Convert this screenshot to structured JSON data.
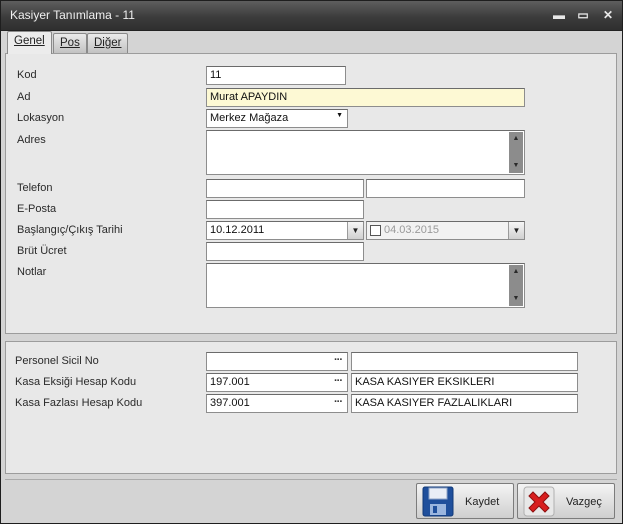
{
  "window": {
    "title": "Kasiyer Tanımlama - 11",
    "controls": {
      "minimize": "▬",
      "maximize": "▭",
      "close": "✕"
    }
  },
  "tabs": [
    {
      "label": "Genel",
      "active": true
    },
    {
      "label": "Pos"
    },
    {
      "label": "Diğer"
    }
  ],
  "general": {
    "kod": {
      "label": "Kod",
      "value": "11"
    },
    "ad": {
      "label": "Ad",
      "value": "Murat APAYDIN"
    },
    "lokasyon": {
      "label": "Lokasyon",
      "value": "Merkez Mağaza"
    },
    "adres": {
      "label": "Adres",
      "value": ""
    },
    "telefon": {
      "label": "Telefon",
      "value1": "",
      "value2": ""
    },
    "eposta": {
      "label": "E-Posta",
      "value": ""
    },
    "tarih": {
      "label": "Başlangıç/Çıkış Tarihi",
      "start": "10.12.2011",
      "end": "04.03.2015",
      "end_checked": false
    },
    "brut": {
      "label": "Brüt Ücret",
      "value": ""
    },
    "notlar": {
      "label": "Notlar",
      "value": ""
    }
  },
  "accounts": {
    "sicil": {
      "label": "Personel Sicil No",
      "code": "",
      "name": ""
    },
    "eksik": {
      "label": "Kasa Eksiği Hesap Kodu",
      "code": "197.001",
      "name": "KASA KASIYER EKSIKLERI"
    },
    "fazla": {
      "label": "Kasa Fazlası Hesap Kodu",
      "code": "397.001",
      "name": "KASA KASIYER FAZLALIKLARI"
    }
  },
  "buttons": {
    "save": "Kaydet",
    "cancel": "Vazgeç"
  },
  "icons": {
    "dropdown": "▼",
    "scroll_up": "▲",
    "scroll_down": "▼",
    "lookup": "···"
  }
}
